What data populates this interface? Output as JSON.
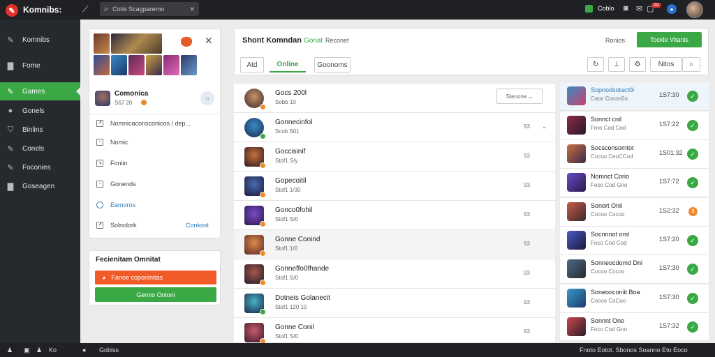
{
  "topbar": {
    "logo_glyph": "✎",
    "title": "Komnibs:",
    "search_text": "Cotis Scagparemo",
    "coins": "Coblo",
    "notification_count": "10",
    "icons": [
      "wand-icon",
      "search-icon",
      "close-icon",
      "gem-icon",
      "camera-icon",
      "bell-icon",
      "user-icon",
      "avatar"
    ]
  },
  "sidebar": {
    "items": [
      {
        "label": "Komnibs",
        "icon": "pen-icon",
        "active": false
      },
      {
        "label": "Fome",
        "icon": "square-icon",
        "active": false
      },
      {
        "label": "Games",
        "icon": "pen-icon",
        "active": true
      },
      {
        "label": "Gonels",
        "icon": "chat-icon",
        "active": false
      },
      {
        "label": "Binlins",
        "icon": "shield-icon",
        "active": false
      },
      {
        "label": "Conels",
        "icon": "pen-icon",
        "active": false
      },
      {
        "label": "Foconies",
        "icon": "pen-icon",
        "active": false
      },
      {
        "label": "Goseagen",
        "icon": "square-icon",
        "active": false
      }
    ]
  },
  "profile_card": {
    "name": "Comonica",
    "sub": "S67 20",
    "rows": [
      {
        "label": "Nomnicaconsconicos / dep...",
        "icon": "doc-icon"
      },
      {
        "label": "Nomic",
        "icon": "doc-icon"
      },
      {
        "label": "Foniin",
        "icon": "edit-icon"
      },
      {
        "label": "Gonends",
        "icon": "doc-icon"
      },
      {
        "label": "Eamoros",
        "icon": "link-icon"
      },
      {
        "label": "Solnolork",
        "icon": "doc-icon"
      }
    ],
    "link_label": "Conkost"
  },
  "action_card": {
    "title": "Fecienitam Omnitat",
    "orange_button": "Fanoe coponinitas",
    "green_button": "Genno Onioni"
  },
  "main": {
    "title": "Shont Komndan",
    "title_accent": "Gonat",
    "subtitle": "Reconet",
    "right_label": "Ronios",
    "primary_button": "Tockle Vitanis",
    "tabs": [
      {
        "label": "Atd",
        "active": false
      },
      {
        "label": "Online",
        "active": true
      },
      {
        "label": "Goonoms",
        "active": false
      }
    ],
    "tools": [
      {
        "icon": "refresh-icon",
        "label": ""
      },
      {
        "icon": "filter-icon",
        "label": ""
      },
      {
        "icon": "settings-icon",
        "label": ""
      },
      {
        "icon": "",
        "label": "Nitos"
      },
      {
        "icon": "search-icon",
        "label": ""
      }
    ],
    "select_label": "Steoone"
  },
  "friends": [
    {
      "name": "Gocs 200l",
      "sub": "Sobb 10",
      "num": "",
      "status": "orange"
    },
    {
      "name": "Gonnecinfol",
      "sub": "Scob S01",
      "num": "93",
      "status": "green"
    },
    {
      "name": "Goccisinif",
      "sub": "Stof1 S/y",
      "num": "93",
      "status": "orange"
    },
    {
      "name": "Gopecoitil",
      "sub": "Stof1 1/30",
      "num": "93",
      "status": "orange"
    },
    {
      "name": "Gonco0fohil",
      "sub": "Stof1 S/0",
      "num": "93",
      "status": "orange"
    },
    {
      "name": "Gonne Conind",
      "sub": "Stof1 1/0",
      "num": "93",
      "status": "orange"
    },
    {
      "name": "Gonneffo0fhande",
      "sub": "Stof1 S/0",
      "num": "93",
      "status": "orange"
    },
    {
      "name": "Dotneis Golanecit",
      "sub": "Stof1 120 10",
      "num": "93",
      "status": "green"
    },
    {
      "name": "Gonne Conil",
      "sub": "Stof1 S/0",
      "num": "93",
      "status": "orange"
    }
  ],
  "requests": [
    {
      "name": "Sopnodsotact0i",
      "sub": "Caoc Cocoo0o",
      "time": "1S7:30",
      "status": "check",
      "highlight": true
    },
    {
      "name": "Sonnct cnil",
      "sub": "Fnro Cod Cod",
      "time": "1S7:22",
      "status": "check",
      "highlight": false
    },
    {
      "name": "Socsconsomtot",
      "sub": "Cocoo CeoCCod",
      "time": "1S01:32",
      "status": "check",
      "highlight": false
    },
    {
      "name": "Nomnct Corio",
      "sub": "Fooo Cod Gno",
      "time": "1S7:72",
      "status": "check",
      "highlight": false
    },
    {
      "name": "Sonort Onil",
      "sub": "Cocoo Cocoo",
      "time": "1S2:32",
      "status": "pending",
      "highlight": false
    },
    {
      "name": "Socnnnot oml",
      "sub": "Fnco Cod Cod",
      "time": "1S7:20",
      "status": "check",
      "highlight": false
    },
    {
      "name": "Sonneocdomd Dni",
      "sub": "Cocoo Cocoo",
      "time": "1S7:30",
      "status": "check",
      "highlight": false
    },
    {
      "name": "Soneooconiit Boa",
      "sub": "Cocoo CoCoo",
      "time": "1S7:30",
      "status": "check",
      "highlight": false
    },
    {
      "name": "Sonnnt Ono",
      "sub": "Fnco Cod Gno",
      "time": "1S7:32",
      "status": "check",
      "highlight": false
    }
  ],
  "bottombar": {
    "icons": [
      "user-icon",
      "chat-icon"
    ],
    "left_label": "Ko",
    "center_label": "Gobiss",
    "right_text": "Fnoto Eotot. Sbonos Soanno Eto Eoco"
  },
  "colors": {
    "accent_green": "#3aa845",
    "accent_orange": "#f05a28",
    "brand_red": "#e0312b",
    "dark_bar": "#1f2124"
  }
}
